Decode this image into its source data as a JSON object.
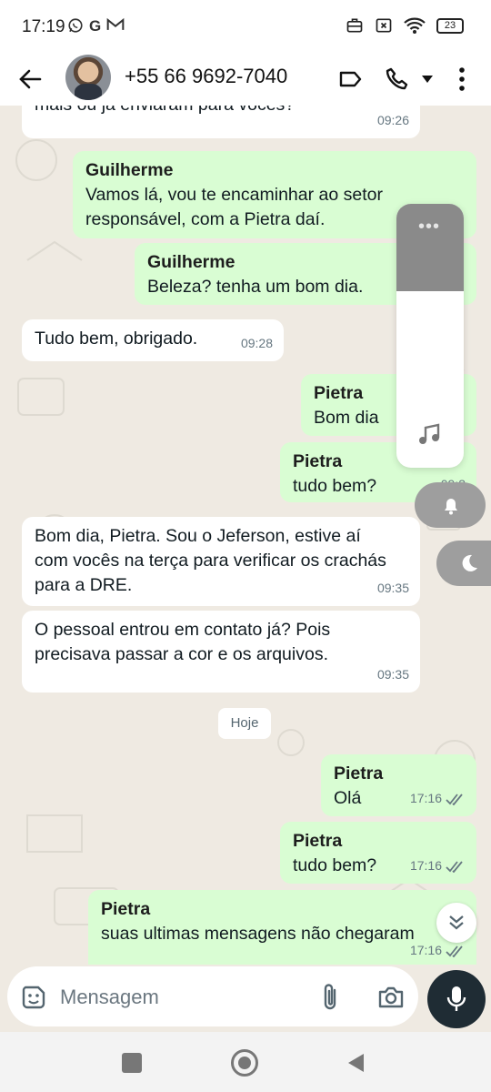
{
  "status_bar": {
    "time": "17:19",
    "left_icons": [
      "whatsapp-icon",
      "G",
      "gmail-icon"
    ],
    "battery": "23"
  },
  "header": {
    "contact": "+55 66 9692-7040"
  },
  "messages": [
    {
      "dir": "in",
      "text": "mais ou já enviaram para vocês?",
      "time": "09:26"
    },
    {
      "dir": "out",
      "sender": "Guilherme",
      "text": "Vamos lá, vou te encaminhar ao setor responsável, com a Pietra daí."
    },
    {
      "dir": "out",
      "sender": "Guilherme",
      "text": "Beleza? tenha um bom dia."
    },
    {
      "dir": "in",
      "text": "Tudo bem, obrigado.",
      "time": "09:28"
    },
    {
      "dir": "out",
      "sender": "Pietra",
      "text": "Bom dia"
    },
    {
      "dir": "out",
      "sender": "Pietra",
      "text": "tudo bem?",
      "time": "09:3"
    },
    {
      "dir": "in",
      "text": "Bom dia, Pietra. Sou o Jeferson, estive aí com vocês na terça para verificar os crachás para a DRE.",
      "time": "09:35"
    },
    {
      "dir": "in",
      "text": "O pessoal entrou em contato já? Pois precisava passar a cor e os arquivos.",
      "time": "09:35"
    },
    {
      "dir": "out",
      "sender": "Pietra",
      "text": "Olá",
      "time": "17:16"
    },
    {
      "dir": "out",
      "sender": "Pietra",
      "text": "tudo bem?",
      "time": "17:16"
    },
    {
      "dir": "out",
      "sender": "Pietra",
      "text": "suas ultimas mensagens não chegaram",
      "time": "17:16"
    }
  ],
  "date_chip": "Hoje",
  "input": {
    "placeholder": "Mensagem"
  },
  "volume": {
    "level": 0.33
  },
  "colors": {
    "outgoing": "#d9fdd3",
    "incoming": "#ffffff",
    "background": "#efeae2",
    "accent": "#1f2c34",
    "ticks": "#667781"
  }
}
